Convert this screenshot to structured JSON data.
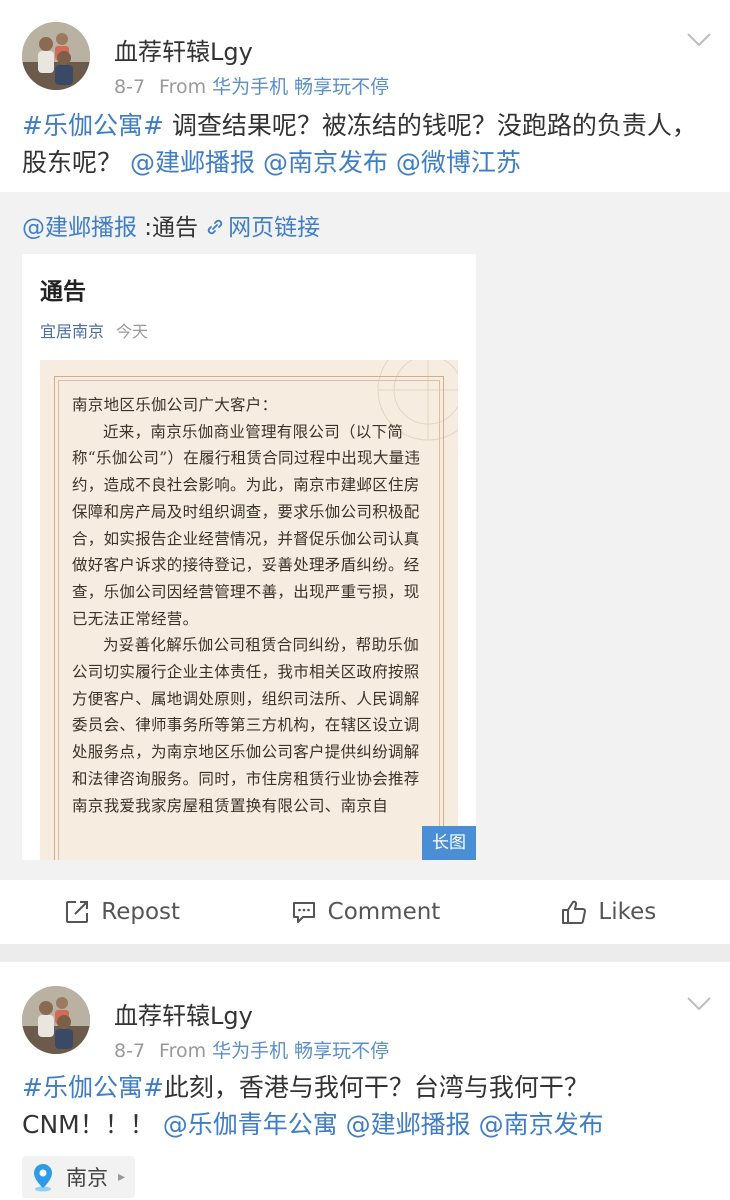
{
  "posts": [
    {
      "username": "血荐轩辕Lgy",
      "date": "8-7",
      "from_label": "From",
      "source": "华为手机 畅享玩不停",
      "text_segments": {
        "hashtag": "#乐伽公寓#",
        "body": " 调查结果呢？被冻结的钱呢？没跑路的负责人，股东呢？",
        "mention1": "@建邺播报",
        "mention2": "@南京发布",
        "mention3": "@微博江苏"
      },
      "retweet": {
        "mention": "@建邺播报",
        "colon_text": " :通告",
        "link_text": "网页链接",
        "card": {
          "title": "通告",
          "source": "宜居南京",
          "date": "今天",
          "long_badge": "长图",
          "notice_lines": {
            "salutation": "南京地区乐伽公司广大客户：",
            "p1": "近来，南京乐伽商业管理有限公司（以下简称“乐伽公司”）在履行租赁合同过程中出现大量违约，造成不良社会影响。为此，南京市建邺区住房保障和房产局及时组织调查，要求乐伽公司积极配合，如实报告企业经营情况，并督促乐伽公司认真做好客户诉求的接待登记，妥善处理矛盾纠纷。经查，乐伽公司因经营管理不善，出现严重亏损，现已无法正常经营。",
            "p2": "为妥善化解乐伽公司租赁合同纠纷，帮助乐伽公司切实履行企业主体责任，我市相关区政府按照方便客户、属地调处原则，组织司法所、人民调解委员会、律师事务所等第三方机构，在辖区设立调处服务点，为南京地区乐伽公司客户提供纠纷调解和法律咨询服务。同时，市住房租赁行业协会推荐南京我爱我家房屋租赁置换有限公司、南京自"
          }
        }
      },
      "actions": {
        "repost": "Repost",
        "comment": "Comment",
        "likes": "Likes"
      }
    },
    {
      "username": "血荐轩辕Lgy",
      "date": "8-7",
      "from_label": "From",
      "source": "华为手机 畅享玩不停",
      "text_segments": {
        "hashtag": "#乐伽公寓#",
        "body": "此刻，香港与我何干？台湾与我何干？CNM！！！",
        "mention1": "@乐伽青年公寓",
        "mention2": "@建邺播报",
        "mention3": "@南京发布"
      },
      "location": "南京"
    }
  ],
  "icons": {
    "chevron": "chevron-down-icon",
    "link": "link-icon",
    "repost": "repost-icon",
    "comment": "comment-icon",
    "like": "thumbs-up-icon",
    "location": "location-pin-icon"
  },
  "colors": {
    "link": "#3f7ec4",
    "long_badge": "#4a8fd6",
    "divider": "#ececec",
    "retweet_bg": "#f2f2f2"
  }
}
